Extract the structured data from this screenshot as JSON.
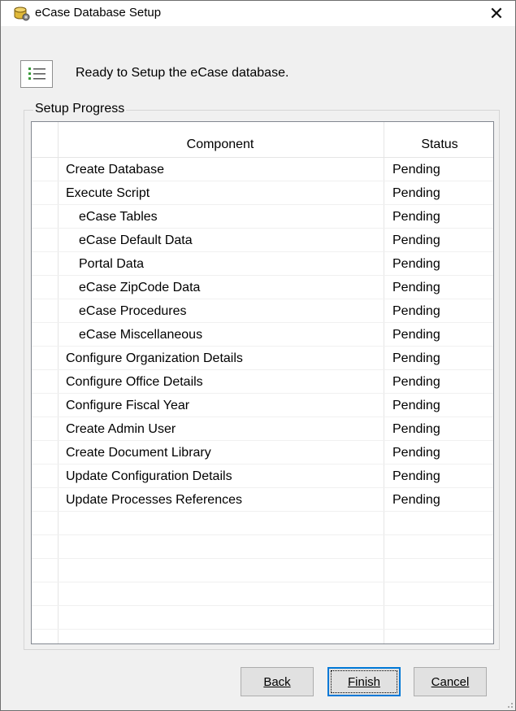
{
  "window": {
    "title": "eCase Database Setup",
    "close_glyph": "✕",
    "icon": "database-icon"
  },
  "header": {
    "icon": "checklist-icon",
    "message": "Ready to Setup the eCase database."
  },
  "group": {
    "label": "Setup Progress"
  },
  "table": {
    "columns": [
      "Component",
      "Status"
    ],
    "rows": [
      {
        "component": "Create Database",
        "status": "Pending"
      },
      {
        "component": "Execute Script",
        "status": "Pending"
      },
      {
        "component": "eCase Tables",
        "status": "Pending"
      },
      {
        "component": "eCase Default Data",
        "status": "Pending"
      },
      {
        "component": "Portal Data",
        "status": "Pending"
      },
      {
        "component": "eCase ZipCode Data",
        "status": "Pending"
      },
      {
        "component": "eCase Procedures",
        "status": "Pending"
      },
      {
        "component": "eCase Miscellaneous",
        "status": "Pending"
      },
      {
        "component": "Configure Organization Details",
        "status": "Pending"
      },
      {
        "component": "Configure Office Details",
        "status": "Pending"
      },
      {
        "component": "Configure Fiscal Year",
        "status": "Pending"
      },
      {
        "component": "Create Admin User",
        "status": "Pending"
      },
      {
        "component": "Create Document Library",
        "status": "Pending"
      },
      {
        "component": "Update Configuration Details",
        "status": "Pending"
      },
      {
        "component": "Update Processes References",
        "status": "Pending"
      }
    ]
  },
  "buttons": {
    "back": "Back",
    "finish": "Finish",
    "cancel": "Cancel"
  },
  "colors": {
    "focus_border": "#0078d7",
    "dialog_bg": "#f0f0f0"
  }
}
